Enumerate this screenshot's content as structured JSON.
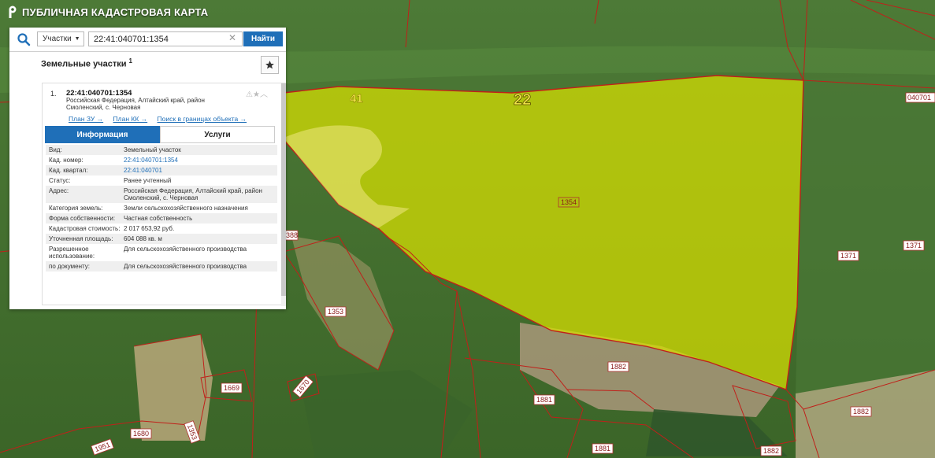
{
  "app": {
    "title": "ПУБЛИЧНАЯ КАДАСТРОВАЯ КАРТА"
  },
  "search": {
    "type_label": "Участки",
    "query": "22:41:040701:1354",
    "button_label": "Найти"
  },
  "results": {
    "heading": "Земельные участки",
    "count": "1",
    "item": {
      "index": "1.",
      "cad_number": "22:41:040701:1354",
      "address": "Российская Федерация, Алтайский край, район Смоленский, с. Черновая",
      "links": [
        "План ЗУ →",
        "План КК →",
        "Поиск в границах объекта →"
      ],
      "tabs": [
        "Информация",
        "Услуги"
      ],
      "rows": [
        {
          "k": "Вид:",
          "v": "Земельный участок"
        },
        {
          "k": "Кад. номер:",
          "v": "22:41:040701:1354"
        },
        {
          "k": "Кад. квартал:",
          "v": "22:41:040701"
        },
        {
          "k": "Статус:",
          "v": "Ранее учтенный"
        },
        {
          "k": "Адрес:",
          "v": "Российская Федерация, Алтайский край, район Смоленский, с. Черновая"
        },
        {
          "k": "Категория земель:",
          "v": "Земли сельскохозяйственного назначения"
        },
        {
          "k": "Форма собственности:",
          "v": "Частная собственность"
        },
        {
          "k": "Кадастровая стоимость:",
          "v": "2 017 653,92 руб."
        },
        {
          "k": "Уточненная площадь:",
          "v": "604 088 кв. м"
        },
        {
          "k": "Разрешенное использование:",
          "v": "Для сельскохозяйственного производства"
        },
        {
          "k": "по документу:",
          "v": "Для сельскохозяйственного производства"
        }
      ]
    }
  },
  "map": {
    "district_labels": [
      "41",
      "22"
    ],
    "parcel_labels": [
      "1354",
      "1371",
      "1371",
      "1353",
      "1882",
      "1882",
      "1882",
      "1881",
      "1881",
      "1669",
      "1670",
      "1680",
      "1951",
      "1353",
      "388",
      "040701"
    ],
    "colors": {
      "highlight": "#d8e100",
      "boundary": "#c0201a",
      "district_label": "#f4e94a"
    }
  }
}
